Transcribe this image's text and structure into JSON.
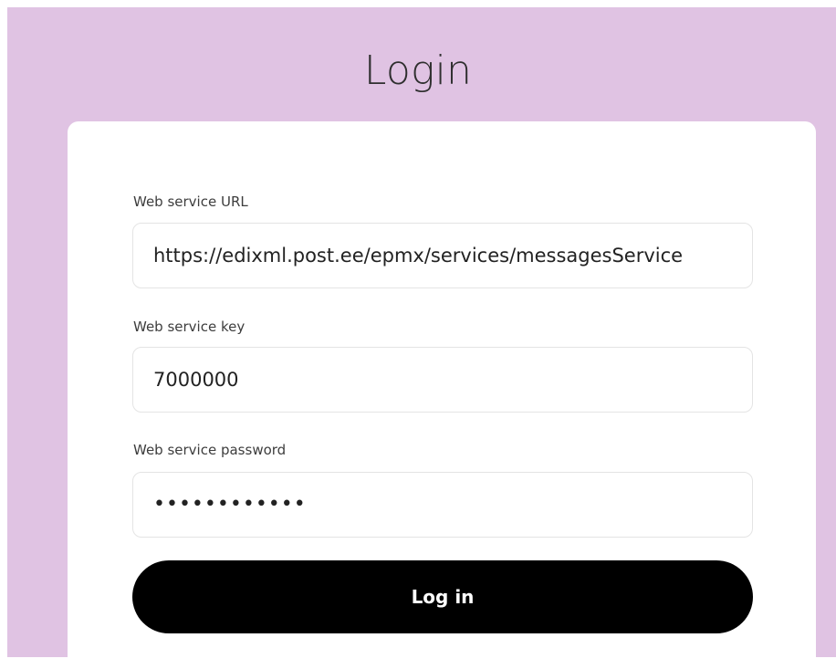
{
  "page": {
    "title": "Login",
    "background_color": "#e0c3e3"
  },
  "form": {
    "url": {
      "label": "Web service URL",
      "value": "https://edixml.post.ee/epmx/services/messagesService"
    },
    "key": {
      "label": "Web service key",
      "value": "7000000"
    },
    "password": {
      "label": "Web service password",
      "value": "••••••••••••"
    },
    "submit": {
      "label": "Log in",
      "color": "#000000"
    }
  }
}
